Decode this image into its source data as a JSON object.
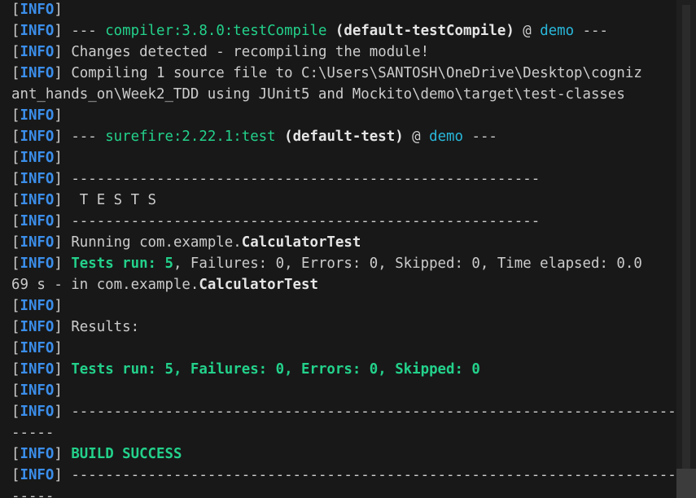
{
  "terminal": {
    "lines": [
      [
        {
          "t": "[",
          "c": ""
        },
        {
          "t": "INFO",
          "c": "info"
        },
        {
          "t": "]",
          "c": ""
        }
      ],
      [
        {
          "t": "[",
          "c": ""
        },
        {
          "t": "INFO",
          "c": "info"
        },
        {
          "t": "] --- ",
          "c": ""
        },
        {
          "t": "compiler:3.8.0:testCompile",
          "c": "plugin"
        },
        {
          "t": " ",
          "c": ""
        },
        {
          "t": "(default-testCompile)",
          "c": "bold"
        },
        {
          "t": " @ ",
          "c": ""
        },
        {
          "t": "demo",
          "c": "link"
        },
        {
          "t": " ---",
          "c": ""
        }
      ],
      [
        {
          "t": "[",
          "c": ""
        },
        {
          "t": "INFO",
          "c": "info"
        },
        {
          "t": "] Changes detected - recompiling the module!",
          "c": ""
        }
      ],
      [
        {
          "t": "[",
          "c": ""
        },
        {
          "t": "INFO",
          "c": "info"
        },
        {
          "t": "] Compiling 1 source file to C:\\Users\\SANTOSH\\OneDrive\\Desktop\\cogniz",
          "c": ""
        }
      ],
      [
        {
          "t": "ant_hands_on\\Week2_TDD using JUnit5 and Mockito\\demo\\target\\test-classes",
          "c": ""
        }
      ],
      [
        {
          "t": "[",
          "c": ""
        },
        {
          "t": "INFO",
          "c": "info"
        },
        {
          "t": "]",
          "c": ""
        }
      ],
      [
        {
          "t": "[",
          "c": ""
        },
        {
          "t": "INFO",
          "c": "info"
        },
        {
          "t": "] --- ",
          "c": ""
        },
        {
          "t": "surefire:2.22.1:test",
          "c": "plugin"
        },
        {
          "t": " ",
          "c": ""
        },
        {
          "t": "(default-test)",
          "c": "bold"
        },
        {
          "t": " @ ",
          "c": ""
        },
        {
          "t": "demo",
          "c": "link"
        },
        {
          "t": " ---",
          "c": ""
        }
      ],
      [
        {
          "t": "[",
          "c": ""
        },
        {
          "t": "INFO",
          "c": "info"
        },
        {
          "t": "]",
          "c": ""
        }
      ],
      [
        {
          "t": "[",
          "c": ""
        },
        {
          "t": "INFO",
          "c": "info"
        },
        {
          "t": "] -------------------------------------------------------",
          "c": ""
        }
      ],
      [
        {
          "t": "[",
          "c": ""
        },
        {
          "t": "INFO",
          "c": "info"
        },
        {
          "t": "]  T E S T S",
          "c": ""
        }
      ],
      [
        {
          "t": "[",
          "c": ""
        },
        {
          "t": "INFO",
          "c": "info"
        },
        {
          "t": "] -------------------------------------------------------",
          "c": ""
        }
      ],
      [
        {
          "t": "[",
          "c": ""
        },
        {
          "t": "INFO",
          "c": "info"
        },
        {
          "t": "] Running com.example.",
          "c": ""
        },
        {
          "t": "CalculatorTest",
          "c": "bold"
        }
      ],
      [
        {
          "t": "[",
          "c": ""
        },
        {
          "t": "INFO",
          "c": "info"
        },
        {
          "t": "] ",
          "c": ""
        },
        {
          "t": "Tests run: 5",
          "c": "ok"
        },
        {
          "t": ", Failures: 0, Errors: 0, Skipped: 0, Time elapsed: 0.0",
          "c": ""
        }
      ],
      [
        {
          "t": "69 s - in com.example.",
          "c": ""
        },
        {
          "t": "CalculatorTest",
          "c": "bold"
        }
      ],
      [
        {
          "t": "[",
          "c": ""
        },
        {
          "t": "INFO",
          "c": "info"
        },
        {
          "t": "]",
          "c": ""
        }
      ],
      [
        {
          "t": "[",
          "c": ""
        },
        {
          "t": "INFO",
          "c": "info"
        },
        {
          "t": "] Results:",
          "c": ""
        }
      ],
      [
        {
          "t": "[",
          "c": ""
        },
        {
          "t": "INFO",
          "c": "info"
        },
        {
          "t": "]",
          "c": ""
        }
      ],
      [
        {
          "t": "[",
          "c": ""
        },
        {
          "t": "INFO",
          "c": "info"
        },
        {
          "t": "] ",
          "c": ""
        },
        {
          "t": "Tests run: 5, Failures: 0, Errors: 0, Skipped: 0",
          "c": "ok"
        }
      ],
      [
        {
          "t": "[",
          "c": ""
        },
        {
          "t": "INFO",
          "c": "info"
        },
        {
          "t": "]",
          "c": ""
        }
      ],
      [
        {
          "t": "[",
          "c": ""
        },
        {
          "t": "INFO",
          "c": "info"
        },
        {
          "t": "] ------------------------------------------------------------------------",
          "c": ""
        }
      ],
      [
        {
          "t": "-----",
          "c": ""
        }
      ],
      [
        {
          "t": "[",
          "c": ""
        },
        {
          "t": "INFO",
          "c": "info"
        },
        {
          "t": "] ",
          "c": ""
        },
        {
          "t": "BUILD SUCCESS",
          "c": "ok"
        }
      ],
      [
        {
          "t": "[",
          "c": ""
        },
        {
          "t": "INFO",
          "c": "info"
        },
        {
          "t": "] ------------------------------------------------------------------------",
          "c": ""
        }
      ],
      [
        {
          "t": "-----",
          "c": ""
        }
      ]
    ]
  },
  "colors": {
    "background": "#181818",
    "foreground": "#cccccc",
    "info_tag": "#3b8eea",
    "plugin": "#23d18b",
    "success": "#23d18b",
    "project_link": "#29b8db",
    "scrollbar_track": "#1f1f1f",
    "scrollbar_thumb": "#3c3c3c"
  }
}
